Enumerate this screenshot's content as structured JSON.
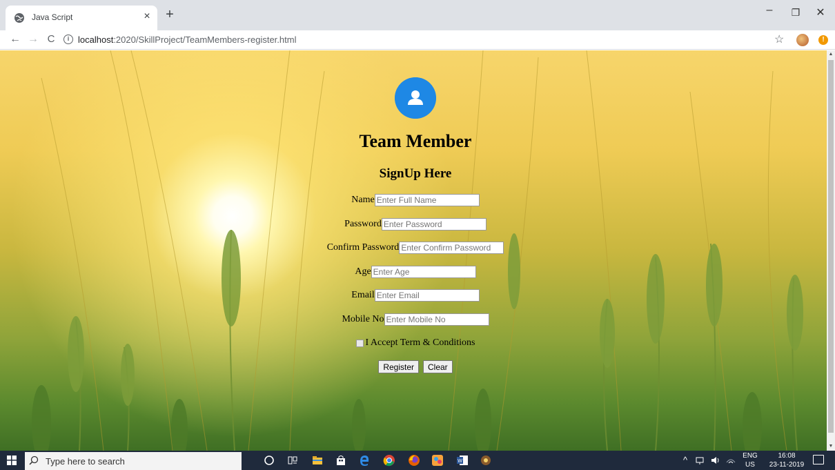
{
  "browser": {
    "tab_title": "Java Script",
    "tab_close": "×",
    "new_tab": "+",
    "url_host": "localhost",
    "url_path": ":2020/SkillProject/TeamMembers-register.html"
  },
  "form": {
    "title": "Team Member",
    "subtitle": "SignUp Here",
    "fields": [
      {
        "label": "Name",
        "placeholder": "Enter Full Name"
      },
      {
        "label": "Password",
        "placeholder": "Enter Password"
      },
      {
        "label": "Confirm Password",
        "placeholder": "Enter Confirm Password"
      },
      {
        "label": "Age",
        "placeholder": "Enter Age"
      },
      {
        "label": "Email",
        "placeholder": "Enter Email"
      },
      {
        "label": "Mobile No",
        "placeholder": "Enter Mobile No"
      }
    ],
    "terms_label": "I Accept Term & Conditions",
    "register_label": "Register",
    "clear_label": "Clear"
  },
  "taskbar": {
    "search_placeholder": "Type here to search",
    "lang_top": "ENG",
    "lang_bottom": "US",
    "time": "16:08",
    "date": "23-11-2019"
  },
  "colors": {
    "avatar": "#1e88e5",
    "taskbar": "#1f2a3c"
  }
}
